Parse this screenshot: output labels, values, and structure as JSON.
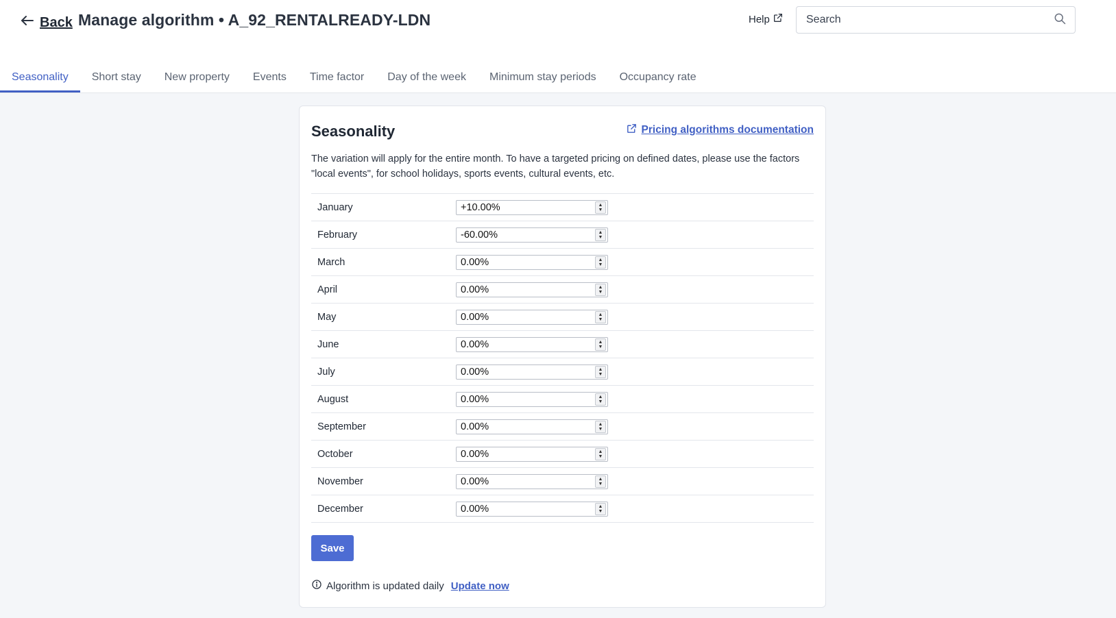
{
  "header": {
    "back_label": "Back",
    "title": "Manage algorithm • A_92_RENTALREADY-LDN",
    "help_label": "Help",
    "search_placeholder": "Search"
  },
  "tabs": [
    {
      "label": "Seasonality",
      "active": true
    },
    {
      "label": "Short stay",
      "active": false
    },
    {
      "label": "New property",
      "active": false
    },
    {
      "label": "Events",
      "active": false
    },
    {
      "label": "Time factor",
      "active": false
    },
    {
      "label": "Day of the week",
      "active": false
    },
    {
      "label": "Minimum stay periods",
      "active": false
    },
    {
      "label": "Occupancy rate",
      "active": false
    }
  ],
  "card": {
    "title": "Seasonality",
    "doc_link": "Pricing algorithms documentation",
    "description": "The variation will apply for the entire month. To have a targeted pricing on defined dates, please use the factors \"local events\", for school holidays, sports events, cultural events, etc.",
    "months": [
      {
        "name": "January",
        "value": "+10.00%"
      },
      {
        "name": "February",
        "value": "-60.00%"
      },
      {
        "name": "March",
        "value": "0.00%"
      },
      {
        "name": "April",
        "value": "0.00%"
      },
      {
        "name": "May",
        "value": "0.00%"
      },
      {
        "name": "June",
        "value": "0.00%"
      },
      {
        "name": "July",
        "value": "0.00%"
      },
      {
        "name": "August",
        "value": "0.00%"
      },
      {
        "name": "September",
        "value": "0.00%"
      },
      {
        "name": "October",
        "value": "0.00%"
      },
      {
        "name": "November",
        "value": "0.00%"
      },
      {
        "name": "December",
        "value": "0.00%"
      }
    ],
    "save_label": "Save",
    "update_text": "Algorithm is updated daily",
    "update_link": "Update now"
  },
  "colors": {
    "accent": "#4160c4",
    "button": "#4d6cd3",
    "background": "#f4f6f9"
  },
  "icons": {
    "back": "arrow-left-icon",
    "help": "external-link-icon",
    "search": "search-icon",
    "doc": "external-link-icon",
    "info": "info-icon"
  }
}
